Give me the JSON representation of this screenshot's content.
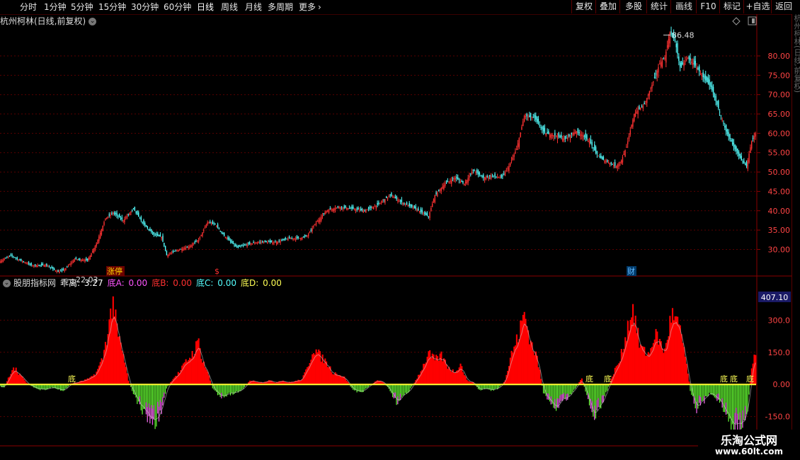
{
  "toolbar": {
    "periods": [
      {
        "label": "分时",
        "active": false
      },
      {
        "label": "1分钟",
        "active": false
      },
      {
        "label": "5分钟",
        "active": false
      },
      {
        "label": "15分钟",
        "active": false
      },
      {
        "label": "30分钟",
        "active": false
      },
      {
        "label": "60分钟",
        "active": false
      },
      {
        "label": "日线",
        "active": true
      },
      {
        "label": "周线",
        "active": false
      },
      {
        "label": "月线",
        "active": false
      },
      {
        "label": "多周期",
        "active": false
      },
      {
        "label": "更多",
        "active": false
      }
    ],
    "more_chevron": "›",
    "right_buttons": [
      "复权",
      "叠加",
      "多股",
      "统计",
      "画线",
      "F10",
      "标记",
      "+自选",
      "返回"
    ]
  },
  "chart_title": "杭州柯林(日线,前复权)",
  "indicator": {
    "name": "股朋指标网",
    "items": [
      {
        "label": "乖离:",
        "value": "3.27",
        "color": "#ffffff"
      },
      {
        "label": "底A:",
        "value": "0.00",
        "color": "#ff55ff"
      },
      {
        "label": "底B:",
        "value": "0.00",
        "color": "#ff3030"
      },
      {
        "label": "底C:",
        "value": "0.00",
        "color": "#55ffff"
      },
      {
        "label": "底D:",
        "value": "0.00",
        "color": "#ffff55"
      }
    ],
    "current_value": "407.10"
  },
  "markers": [
    {
      "text": "涨停",
      "color": "#ffdd00",
      "bg": "#6a0000"
    },
    {
      "text": "$",
      "color": "#ff3030",
      "bg": ""
    },
    {
      "text": "财",
      "color": "#66bbff",
      "bg": "#003a6a"
    }
  ],
  "bottom_labels": [
    "底",
    "底",
    "底",
    "底",
    "底",
    "底"
  ],
  "watermark": {
    "title": "乐淘公式网",
    "url": "www.60lt.com"
  },
  "chart_data": [
    {
      "type": "candlestick",
      "title": "杭州柯林(日线,前复权)",
      "y_ticks": [
        30,
        35,
        40,
        45,
        50,
        55,
        60,
        65,
        70,
        75,
        80
      ],
      "y_tick_labels": [
        "30.00",
        "35.00",
        "40.00",
        "45.00",
        "50.00",
        "55.00",
        "60.00",
        "65.00",
        "70.00",
        "75.00",
        "80.00"
      ],
      "ylim": [
        23.5,
        87.5
      ],
      "annotations": [
        {
          "label": "86.48",
          "value": 86.48
        },
        {
          "label": "22.03",
          "value": 22.03
        }
      ],
      "close_anchors": [
        [
          0,
          27.0
        ],
        [
          8,
          28.5
        ],
        [
          15,
          27.2
        ],
        [
          25,
          25.8
        ],
        [
          35,
          26.0
        ],
        [
          45,
          24.2
        ],
        [
          50,
          24.8
        ],
        [
          58,
          27.5
        ],
        [
          68,
          27.2
        ],
        [
          75,
          31.5
        ],
        [
          82,
          38.0
        ],
        [
          88,
          39.5
        ],
        [
          96,
          37.5
        ],
        [
          104,
          40.5
        ],
        [
          112,
          36.5
        ],
        [
          120,
          33.8
        ],
        [
          126,
          33.2
        ],
        [
          130,
          28.5
        ],
        [
          138,
          29.8
        ],
        [
          148,
          30.8
        ],
        [
          155,
          32.5
        ],
        [
          162,
          37.0
        ],
        [
          168,
          36.5
        ],
        [
          175,
          33.5
        ],
        [
          185,
          30.5
        ],
        [
          195,
          31.5
        ],
        [
          205,
          32.0
        ],
        [
          215,
          31.8
        ],
        [
          225,
          32.8
        ],
        [
          235,
          33.0
        ],
        [
          240,
          33.5
        ],
        [
          246,
          36.5
        ],
        [
          255,
          40.0
        ],
        [
          265,
          41.0
        ],
        [
          275,
          40.5
        ],
        [
          285,
          40.0
        ],
        [
          295,
          41.5
        ],
        [
          305,
          44.0
        ],
        [
          315,
          42.0
        ],
        [
          325,
          40.5
        ],
        [
          335,
          38.5
        ],
        [
          340,
          44.0
        ],
        [
          348,
          47.0
        ],
        [
          356,
          48.5
        ],
        [
          363,
          47.0
        ],
        [
          370,
          50.5
        ],
        [
          378,
          48.5
        ],
        [
          385,
          49.0
        ],
        [
          392,
          48.5
        ],
        [
          398,
          51.5
        ],
        [
          404,
          56.0
        ],
        [
          410,
          64.5
        ],
        [
          418,
          64.0
        ],
        [
          426,
          60.0
        ],
        [
          434,
          59.5
        ],
        [
          442,
          58.5
        ],
        [
          450,
          60.5
        ],
        [
          456,
          59.5
        ],
        [
          462,
          57.5
        ],
        [
          466,
          55.0
        ],
        [
          470,
          53.5
        ],
        [
          476,
          52.5
        ],
        [
          482,
          51.5
        ],
        [
          486,
          53.0
        ],
        [
          490,
          56.5
        ],
        [
          496,
          65.0
        ],
        [
          504,
          67.5
        ],
        [
          510,
          72.5
        ],
        [
          516,
          78.0
        ],
        [
          520,
          79.5
        ],
        [
          524,
          86.0
        ],
        [
          528,
          84.0
        ],
        [
          532,
          77.0
        ],
        [
          538,
          79.5
        ],
        [
          544,
          77.5
        ],
        [
          550,
          74.5
        ],
        [
          556,
          72.0
        ],
        [
          562,
          66.5
        ],
        [
          568,
          60.5
        ],
        [
          574,
          56.5
        ],
        [
          580,
          53.0
        ],
        [
          584,
          51.5
        ],
        [
          588,
          58.0
        ],
        [
          591,
          60.0
        ]
      ]
    },
    {
      "type": "bar",
      "title": "股朋指标网",
      "y_ticks": [
        -150,
        0,
        150,
        300
      ],
      "y_tick_labels": [
        "-150.0",
        "0.00",
        "150.0",
        "300.0"
      ],
      "ylim": [
        -280,
        440
      ],
      "series": [
        {
          "name": "乖离",
          "color": "#ff0000",
          "description": "positive histogram"
        },
        {
          "name": "乖离",
          "color": "#66ff33",
          "description": "negative histogram"
        }
      ],
      "value_anchors": [
        [
          0,
          -10
        ],
        [
          3,
          -15
        ],
        [
          6,
          30
        ],
        [
          10,
          90
        ],
        [
          15,
          50
        ],
        [
          20,
          10
        ],
        [
          25,
          -12
        ],
        [
          30,
          -25
        ],
        [
          35,
          -30
        ],
        [
          40,
          -15
        ],
        [
          45,
          -25
        ],
        [
          50,
          -30
        ],
        [
          55,
          5
        ],
        [
          60,
          10
        ],
        [
          65,
          20
        ],
        [
          70,
          30
        ],
        [
          75,
          60
        ],
        [
          80,
          130
        ],
        [
          85,
          300
        ],
        [
          88,
          420
        ],
        [
          91,
          260
        ],
        [
          96,
          140
        ],
        [
          100,
          20
        ],
        [
          105,
          -60
        ],
        [
          110,
          -120
        ],
        [
          116,
          -170
        ],
        [
          121,
          -200
        ],
        [
          126,
          -130
        ],
        [
          130,
          -20
        ],
        [
          135,
          30
        ],
        [
          140,
          60
        ],
        [
          145,
          110
        ],
        [
          150,
          150
        ],
        [
          155,
          210
        ],
        [
          158,
          120
        ],
        [
          162,
          60
        ],
        [
          166,
          -20
        ],
        [
          172,
          -60
        ],
        [
          178,
          -50
        ],
        [
          185,
          -40
        ],
        [
          190,
          -20
        ],
        [
          195,
          20
        ],
        [
          200,
          15
        ],
        [
          205,
          10
        ],
        [
          210,
          20
        ],
        [
          215,
          10
        ],
        [
          220,
          20
        ],
        [
          225,
          10
        ],
        [
          230,
          15
        ],
        [
          236,
          25
        ],
        [
          240,
          80
        ],
        [
          245,
          180
        ],
        [
          250,
          140
        ],
        [
          255,
          110
        ],
        [
          260,
          60
        ],
        [
          265,
          50
        ],
        [
          270,
          30
        ],
        [
          275,
          -20
        ],
        [
          280,
          -40
        ],
        [
          285,
          -30
        ],
        [
          290,
          0
        ],
        [
          295,
          20
        ],
        [
          300,
          10
        ],
        [
          305,
          -30
        ],
        [
          310,
          -90
        ],
        [
          315,
          -60
        ],
        [
          320,
          -30
        ],
        [
          325,
          20
        ],
        [
          330,
          80
        ],
        [
          335,
          150
        ],
        [
          340,
          120
        ],
        [
          345,
          140
        ],
        [
          350,
          90
        ],
        [
          355,
          60
        ],
        [
          360,
          100
        ],
        [
          365,
          20
        ],
        [
          370,
          10
        ],
        [
          375,
          -30
        ],
        [
          380,
          -20
        ],
        [
          385,
          -30
        ],
        [
          390,
          -20
        ],
        [
          395,
          20
        ],
        [
          400,
          150
        ],
        [
          405,
          230
        ],
        [
          410,
          350
        ],
        [
          415,
          210
        ],
        [
          420,
          130
        ],
        [
          425,
          -40
        ],
        [
          430,
          -100
        ],
        [
          435,
          -120
        ],
        [
          440,
          -80
        ],
        [
          445,
          -60
        ],
        [
          450,
          -20
        ],
        [
          455,
          30
        ],
        [
          460,
          -80
        ],
        [
          465,
          -170
        ],
        [
          470,
          -110
        ],
        [
          475,
          -30
        ],
        [
          480,
          60
        ],
        [
          485,
          120
        ],
        [
          490,
          260
        ],
        [
          495,
          380
        ],
        [
          500,
          200
        ],
        [
          504,
          160
        ],
        [
          508,
          150
        ],
        [
          512,
          250
        ],
        [
          516,
          210
        ],
        [
          520,
          160
        ],
        [
          525,
          340
        ],
        [
          530,
          300
        ],
        [
          535,
          180
        ],
        [
          540,
          -30
        ],
        [
          545,
          -120
        ],
        [
          550,
          -90
        ],
        [
          555,
          -40
        ],
        [
          560,
          -60
        ],
        [
          565,
          -110
        ],
        [
          570,
          -180
        ],
        [
          575,
          -220
        ],
        [
          580,
          -200
        ],
        [
          585,
          -120
        ],
        [
          588,
          80
        ],
        [
          591,
          170
        ]
      ]
    }
  ]
}
